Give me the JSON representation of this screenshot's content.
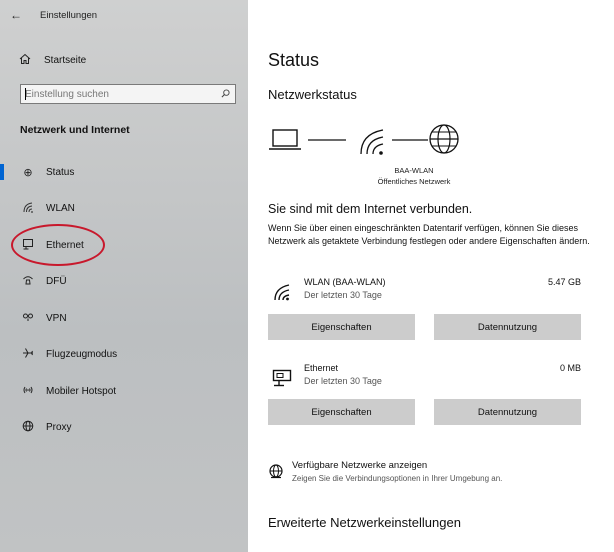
{
  "window": {
    "title": "Einstellungen",
    "back_glyph": "←"
  },
  "sidebar": {
    "home_label": "Startseite",
    "search_placeholder": "Einstellung suchen",
    "section_title": "Netzwerk und Internet",
    "items": [
      {
        "label": "Status",
        "icon": "globe-status-icon",
        "glyph": "⊕",
        "active": true
      },
      {
        "label": "WLAN",
        "icon": "wifi-icon",
        "glyph": "◜",
        "active": false
      },
      {
        "label": "Ethernet",
        "icon": "ethernet-icon",
        "glyph": "⊟",
        "active": false
      },
      {
        "label": "DFÜ",
        "icon": "dialup-icon",
        "glyph": "☏",
        "active": false
      },
      {
        "label": "VPN",
        "icon": "vpn-icon",
        "glyph": "∞",
        "active": false
      },
      {
        "label": "Flugzeugmodus",
        "icon": "airplane-icon",
        "glyph": "✈",
        "active": false
      },
      {
        "label": "Mobiler Hotspot",
        "icon": "hotspot-icon",
        "glyph": "((•))",
        "active": false
      },
      {
        "label": "Proxy",
        "icon": "proxy-globe-icon",
        "glyph": "⊕",
        "active": false
      }
    ],
    "highlight_color": "#c8182c",
    "accent_color": "#0064d2"
  },
  "main": {
    "title": "Status",
    "network_status_heading": "Netzwerkstatus",
    "network": {
      "name": "BAA-WLAN",
      "type": "Öffentliches Netzwerk"
    },
    "connected_title": "Sie sind mit dem Internet verbunden.",
    "connected_desc": "Wenn Sie über einen eingeschränkten Datentarif verfügen, können Sie dieses Netzwerk als getaktete Verbindung festlegen oder andere Eigenschaften ändern.",
    "adapters": [
      {
        "name": "WLAN (BAA-WLAN)",
        "period": "Der letzten 30 Tage",
        "usage": "5.47 GB",
        "properties_label": "Eigenschaften",
        "data_usage_label": "Datennutzung"
      },
      {
        "name": "Ethernet",
        "period": "Der letzten 30 Tage",
        "usage": "0 MB",
        "properties_label": "Eigenschaften",
        "data_usage_label": "Datennutzung"
      }
    ],
    "available": {
      "title": "Verfügbare Netzwerke anzeigen",
      "subtitle": "Zeigen Sie die Verbindungsoptionen in Ihrer Umgebung an."
    },
    "advanced_heading": "Erweiterte Netzwerkeinstellungen"
  }
}
